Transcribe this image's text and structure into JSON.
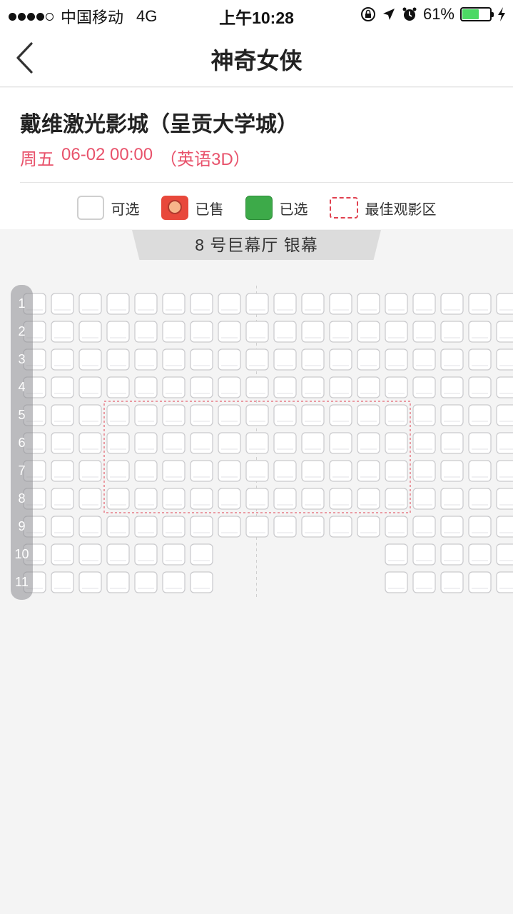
{
  "status_bar": {
    "signal_dots": [
      true,
      true,
      true,
      true,
      false
    ],
    "carrier": "中国移动",
    "network": "4G",
    "time": "上午10:28",
    "icons": [
      "orientation-lock-icon",
      "location-arrow-icon",
      "alarm-icon"
    ],
    "battery_text": "61%",
    "battery_level": 0.61,
    "battery_color": "#4cd964"
  },
  "nav": {
    "back_icon": "chevron-left-icon",
    "title": "神奇女侠"
  },
  "cinema": {
    "name": "戴维激光影城（呈贡大学城）",
    "day": "周五",
    "datetime": "06-02 00:00",
    "version": "（英语3D）",
    "accent_color": "#e8526b"
  },
  "legend": [
    {
      "key": "available",
      "label": "可选"
    },
    {
      "key": "sold",
      "label": "已售"
    },
    {
      "key": "selected",
      "label": "已选"
    },
    {
      "key": "best",
      "label": "最佳观影区"
    }
  ],
  "hall": {
    "screen_label": "8 号巨幕厅 银幕",
    "rows": [
      {
        "label": "1",
        "seats": [
          1,
          1,
          1,
          1,
          1,
          1,
          1,
          1,
          1,
          1,
          1,
          1,
          1,
          1,
          1,
          1,
          1,
          1,
          1
        ]
      },
      {
        "label": "2",
        "seats": [
          1,
          1,
          1,
          1,
          1,
          1,
          1,
          1,
          1,
          1,
          1,
          1,
          1,
          1,
          1,
          1,
          1,
          1,
          1
        ]
      },
      {
        "label": "3",
        "seats": [
          1,
          1,
          1,
          1,
          1,
          1,
          1,
          1,
          1,
          1,
          1,
          1,
          1,
          1,
          1,
          1,
          1,
          1,
          1
        ]
      },
      {
        "label": "4",
        "seats": [
          1,
          1,
          1,
          1,
          1,
          1,
          1,
          1,
          1,
          1,
          1,
          1,
          1,
          1,
          1,
          1,
          1,
          1,
          1
        ]
      },
      {
        "label": "5",
        "seats": [
          1,
          1,
          1,
          1,
          1,
          1,
          1,
          1,
          1,
          1,
          1,
          1,
          1,
          1,
          1,
          1,
          1,
          1,
          1
        ]
      },
      {
        "label": "6",
        "seats": [
          1,
          1,
          1,
          1,
          1,
          1,
          1,
          1,
          1,
          1,
          1,
          1,
          1,
          1,
          1,
          1,
          1,
          1,
          1
        ]
      },
      {
        "label": "7",
        "seats": [
          1,
          1,
          1,
          1,
          1,
          1,
          1,
          1,
          1,
          1,
          1,
          1,
          1,
          1,
          1,
          1,
          1,
          1,
          1
        ]
      },
      {
        "label": "8",
        "seats": [
          1,
          1,
          1,
          1,
          1,
          1,
          1,
          1,
          1,
          1,
          1,
          1,
          1,
          1,
          1,
          1,
          1,
          1,
          1
        ]
      },
      {
        "label": "9",
        "seats": [
          1,
          1,
          1,
          1,
          1,
          1,
          1,
          1,
          1,
          1,
          1,
          1,
          1,
          1,
          1,
          1,
          1,
          1,
          1
        ]
      },
      {
        "label": "10",
        "seats": [
          1,
          1,
          1,
          1,
          1,
          1,
          1,
          0,
          0,
          0,
          0,
          0,
          0,
          1,
          1,
          1,
          1,
          1,
          1
        ]
      },
      {
        "label": "11",
        "seats": [
          1,
          1,
          1,
          1,
          1,
          1,
          1,
          0,
          0,
          0,
          0,
          0,
          0,
          1,
          1,
          1,
          1,
          1,
          1
        ]
      }
    ],
    "best_zone": {
      "rows": [
        "5",
        "8"
      ],
      "seat_columns": [
        3,
        13
      ]
    }
  }
}
